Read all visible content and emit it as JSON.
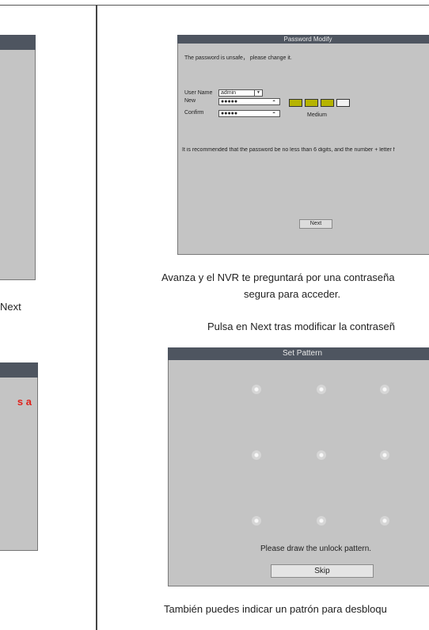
{
  "left_column": {
    "next_fragment": "Next",
    "red_fragment": "s a"
  },
  "password_dialog": {
    "title": "Password Modify",
    "warning": "The password is unsafe， please change it.",
    "user_name_label": "User Name",
    "user_name_value": "admin",
    "new_label": "New",
    "new_value": "●●●●●",
    "confirm_label": "Confirm",
    "confirm_value": "●●●●●",
    "strength_label": "Medium",
    "strength_level": 3,
    "strength_total": 4,
    "strength_color": "#b6b400",
    "recommendation": "It is recommended that the password be no less than 6 digits, and the number + letter f",
    "next_button": "Next"
  },
  "captions": {
    "cap1_line1": "Avanza y el NVR te preguntará por una contraseña",
    "cap1_line2": "segura para acceder.",
    "cap2": "Pulsa en Next tras modificar la contraseñ",
    "cap3": "También puedes indicar un patrón para desbloqu"
  },
  "pattern_dialog": {
    "title": "Set Pattern",
    "message": "Please draw the unlock pattern.",
    "skip_button": "Skip"
  },
  "icons": {
    "dropdown": "chevron-down-icon",
    "reveal": "eye-icon"
  }
}
